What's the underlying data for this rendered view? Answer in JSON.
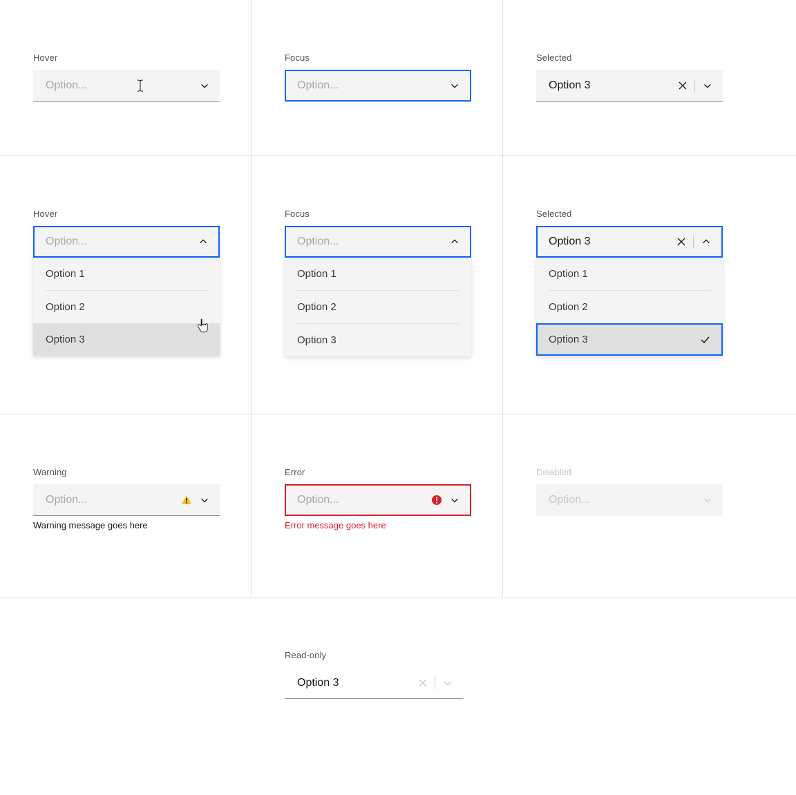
{
  "labels": {
    "hover": "Hover",
    "focus": "Focus",
    "selected": "Selected",
    "warning": "Warning",
    "error": "Error",
    "disabled": "Disabled",
    "readonly": "Read-only"
  },
  "placeholder": "Option...",
  "selectedValue": "Option 3",
  "options": [
    "Option 1",
    "Option 2",
    "Option 3"
  ],
  "messages": {
    "warning": "Warning message goes here",
    "error": "Error message goes here"
  }
}
